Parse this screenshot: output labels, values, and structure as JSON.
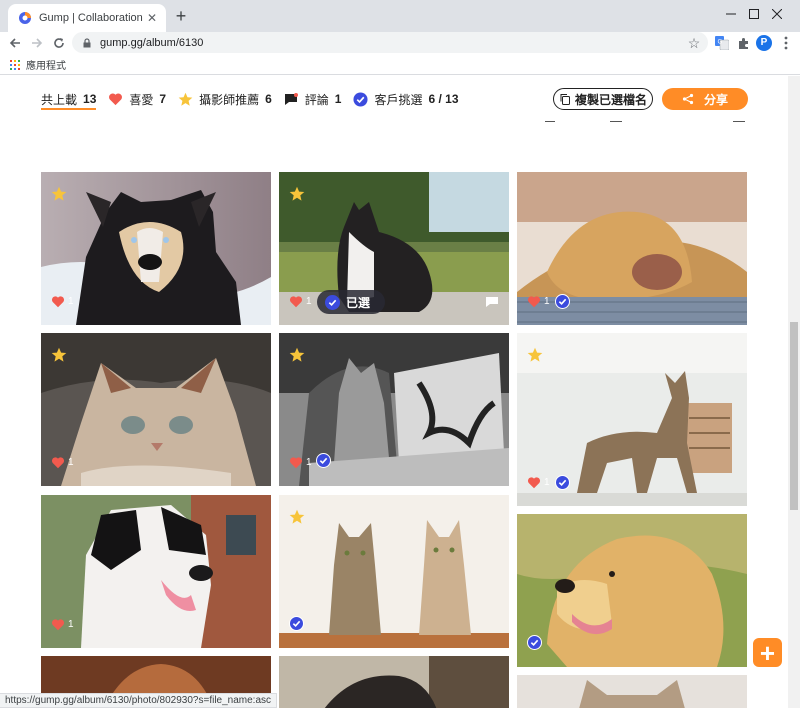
{
  "browser": {
    "tab_title": "Gump | Collaboration Platform",
    "url": "gump.gg/album/6130",
    "bookmark_apps_label": "應用程式",
    "profile_initial": "P",
    "status_url": "https://gump.gg/album/6130/photo/802930?s=file_name:asc"
  },
  "filters": [
    {
      "label": "共上載",
      "count": "13",
      "icon": "none"
    },
    {
      "label": "喜愛",
      "count": "7",
      "icon": "heart-icon"
    },
    {
      "label": "攝影師推薦",
      "count": "6",
      "icon": "star-icon"
    },
    {
      "label": "評論",
      "count": "1",
      "icon": "comment-icon"
    },
    {
      "label": "客戶挑選",
      "count": "6 / 13",
      "icon": "check-circle-icon"
    }
  ],
  "actions": {
    "copy_label": "複製已選檔名",
    "share_label": "分享"
  },
  "photos": [
    {
      "subject": "husky dog",
      "starred": true,
      "likes": "1",
      "client_selected": false
    },
    {
      "subject": "black and white cat",
      "starred": true,
      "likes": "1",
      "client_selected": true,
      "selected_label": "已選",
      "has_comment": true
    },
    {
      "subject": "labrador resting",
      "starred": false,
      "likes": "1",
      "client_selected": true
    },
    {
      "subject": "crouching cat",
      "starred": true,
      "likes": "1",
      "client_selected": false
    },
    {
      "subject": "cat on laptop",
      "starred": true,
      "likes": "1",
      "client_selected": true
    },
    {
      "subject": "standing tabby cat",
      "starred": true,
      "likes": "1",
      "client_selected": true
    },
    {
      "subject": "border collie",
      "starred": false,
      "likes": "1",
      "client_selected": false
    },
    {
      "subject": "two cats",
      "starred": true,
      "likes": "",
      "client_selected": true
    },
    {
      "subject": "golden retriever",
      "starred": false,
      "likes": "",
      "client_selected": true
    }
  ],
  "colors": {
    "accent": "#ff8c26",
    "select_blue": "#3b4bde",
    "heart": "#f25a4e",
    "star": "#f7c43a"
  },
  "fab_icon": "plus-icon"
}
